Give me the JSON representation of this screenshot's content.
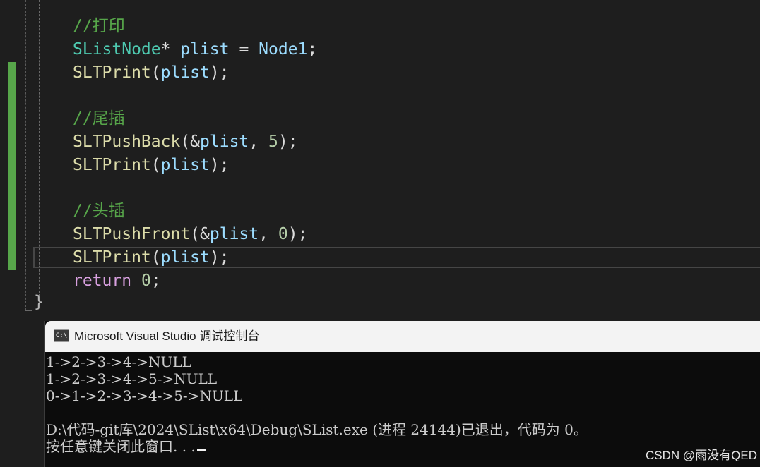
{
  "editor": {
    "lines": [
      {
        "comment": "//打印"
      },
      {
        "type": "SListNode",
        "op1": "*",
        "var": "plist",
        "op2": " = ",
        "value": "Node1",
        "end": ";"
      },
      {
        "fn": "SLTPrint",
        "open": "(",
        "arg": "plist",
        "close": ");"
      },
      {
        "comment": "//尾插"
      },
      {
        "fn": "SLTPushBack",
        "open": "(&",
        "arg": "plist",
        "sep": ", ",
        "num": "5",
        "close": ");"
      },
      {
        "fn": "SLTPrint",
        "open": "(",
        "arg": "plist",
        "close": ");"
      },
      {
        "comment": "//头插"
      },
      {
        "fn": "SLTPushFront",
        "open": "(&",
        "arg": "plist",
        "sep": ", ",
        "num": "0",
        "close": ");"
      },
      {
        "fn": "SLTPrint",
        "open": "(",
        "arg": "plist",
        "close": ");"
      },
      {
        "kw": "return",
        "num": "0",
        "end": ";"
      }
    ],
    "closing_brace": "}"
  },
  "console": {
    "icon_label": "C:\\",
    "title": "Microsoft Visual Studio 调试控制台",
    "output": [
      "1->2->3->4->NULL",
      "1->2->3->4->5->NULL",
      "0->1->2->3->4->5->NULL",
      "",
      "D:\\代码-git库\\2024\\SList\\x64\\Debug\\SList.exe (进程 24144)已退出，代码为 0。",
      "按任意键关闭此窗口. . ."
    ]
  },
  "watermark": "CSDN @雨没有QED",
  "colors": {
    "comment": "#57a64a",
    "type": "#4ec9b0",
    "variable": "#9cdcfe",
    "function": "#dcdcaa",
    "number": "#b5cea8",
    "keyword": "#d8a0df",
    "change_bar": "#57a64a"
  }
}
